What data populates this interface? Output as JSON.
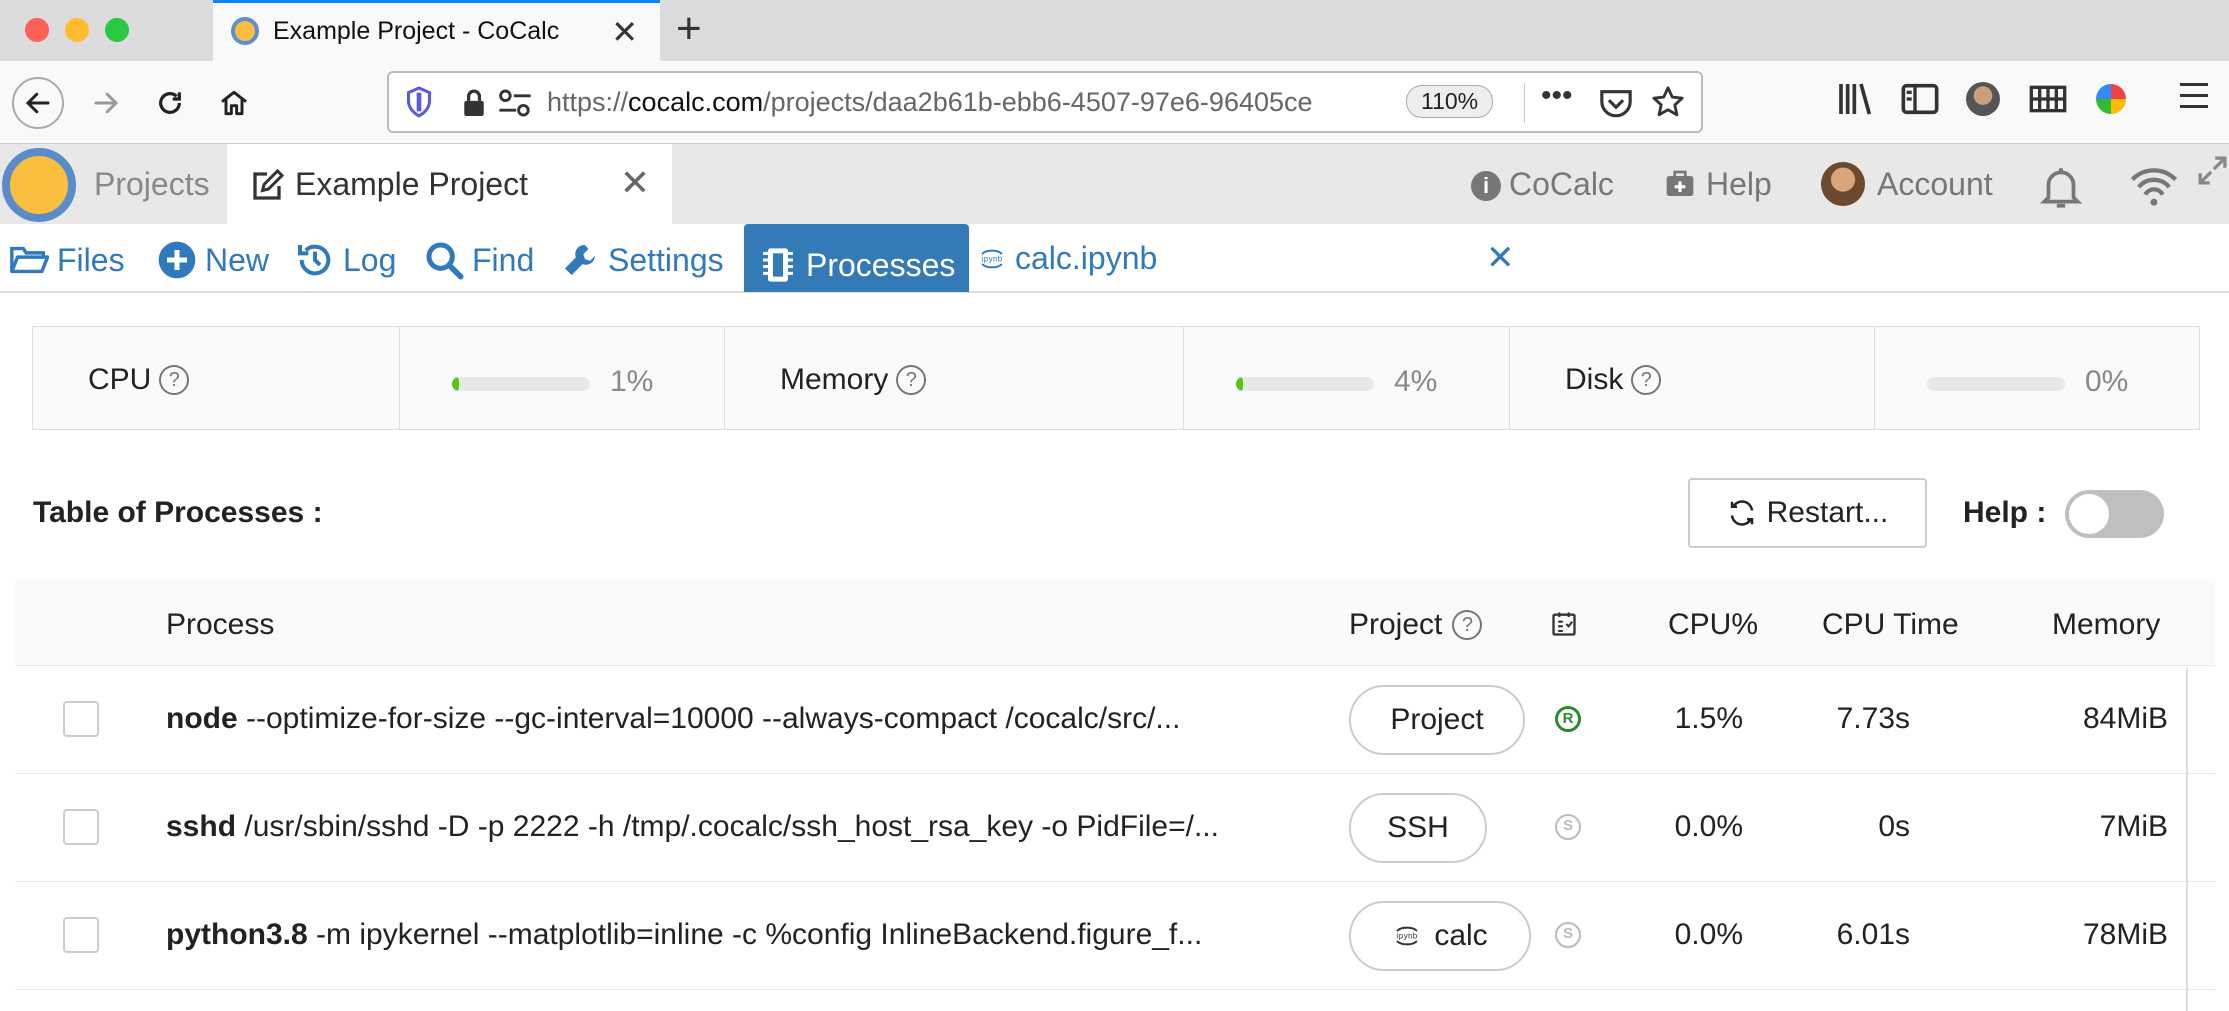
{
  "browser": {
    "tab_title": "Example Project - CoCalc",
    "new_tab": "+",
    "close": "✕",
    "url_domain": "cocalc.com",
    "url_prefix": "https://",
    "url_path": "/projects/daa2b61b-ebb6-4507-97e6-96405ce",
    "zoom": "110%",
    "more": "•••"
  },
  "cocalc": {
    "projects_label": "Projects",
    "project_title": "Example Project",
    "close": "✕",
    "cocalc_label": "CoCalc",
    "help_label": "Help",
    "account_label": "Account"
  },
  "project_tabs": {
    "files": "Files",
    "new": "New",
    "log": "Log",
    "find": "Find",
    "settings": "Settings",
    "processes": "Processes",
    "notebook": "calc.ipynb",
    "close": "✕"
  },
  "stats": {
    "cpu": {
      "label": "CPU",
      "percent_text": "1%",
      "fraction": 0.01
    },
    "memory": {
      "label": "Memory",
      "percent_text": "4%",
      "fraction": 0.04
    },
    "disk": {
      "label": "Disk",
      "percent_text": "0%",
      "fraction": 0.0
    }
  },
  "toolbar": {
    "table_title": "Table of Processes :",
    "restart_label": "Restart...",
    "help_label": "Help :",
    "help_enabled": false
  },
  "table": {
    "headers": {
      "process": "Process",
      "project": "Project",
      "cpu_pct": "CPU%",
      "cpu_time": "CPU Time",
      "memory": "Memory"
    },
    "rows": [
      {
        "cmd": "node",
        "args": "--optimize-for-size --gc-interval=10000 --always-compact /cocalc/src/...",
        "tag": "Project",
        "type_letter": "R",
        "cpu_pct": "1.5%",
        "cpu_time": "7.73s",
        "memory": "84MiB"
      },
      {
        "cmd": "sshd",
        "args": "/usr/sbin/sshd -D -p 2222 -h /tmp/.cocalc/ssh_host_rsa_key -o PidFile=/...",
        "tag": "SSH",
        "type_letter": "S",
        "cpu_pct": "0.0%",
        "cpu_time": "0s",
        "memory": "7MiB"
      },
      {
        "cmd": "python3.8",
        "args": "-m ipykernel --matplotlib=inline -c %config InlineBackend.figure_f...",
        "tag": "calc",
        "type_letter": "S",
        "cpu_pct": "0.0%",
        "cpu_time": "6.01s",
        "memory": "78MiB"
      }
    ]
  },
  "colors": {
    "link_blue": "#2f79bc",
    "active_tab": "#337ab7",
    "progress_green": "#52c41a",
    "running_green": "#2b8a2b"
  }
}
